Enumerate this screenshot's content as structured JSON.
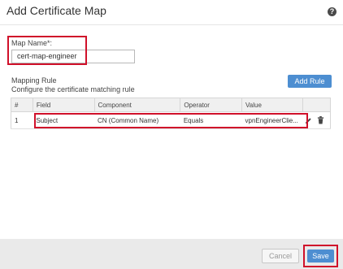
{
  "dialog": {
    "title": "Add Certificate Map",
    "help_icon": "?"
  },
  "map_name": {
    "label": "Map Name*:",
    "value": "cert-map-engineer"
  },
  "mapping_rule": {
    "heading": "Mapping Rule",
    "description": "Configure the certificate matching rule",
    "add_rule_label": "Add Rule"
  },
  "table": {
    "columns": [
      "#",
      "Field",
      "Component",
      "Operator",
      "Value"
    ],
    "rows": [
      {
        "index": "1",
        "field": "Subject",
        "component": "CN (Common Name)",
        "operator": "Equals",
        "value": "vpnEngineerClie..."
      }
    ],
    "row_icons": [
      "pencil-icon",
      "trash-icon"
    ]
  },
  "footer": {
    "cancel_label": "Cancel",
    "save_label": "Save"
  },
  "colors": {
    "accent": "#4d8ed1",
    "highlight": "#d0102a",
    "footer_bg": "#eaeaea"
  }
}
